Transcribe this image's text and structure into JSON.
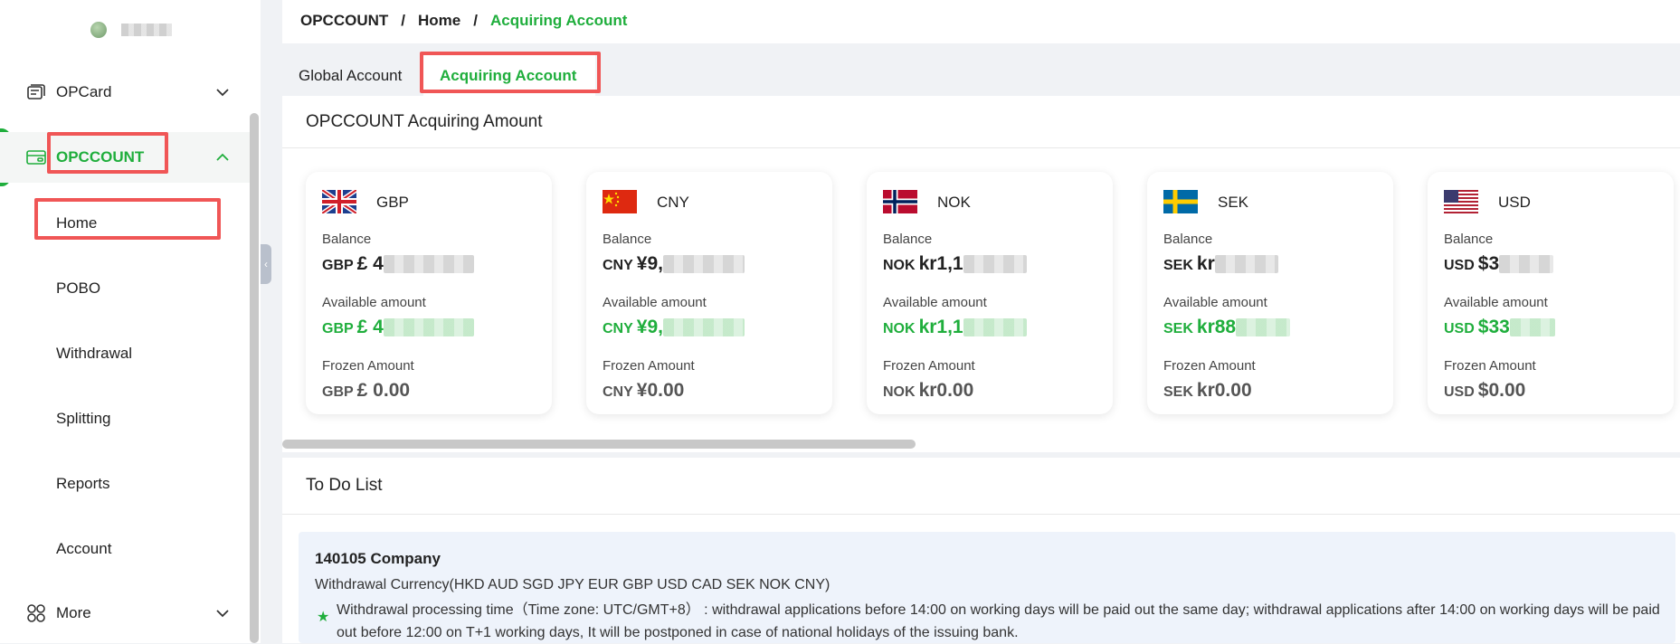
{
  "sidebar": {
    "groups": [
      {
        "label": "OPCard",
        "icon": "card-stack-icon"
      },
      {
        "label": "OPCCOUNT",
        "icon": "wallet-icon"
      },
      {
        "label": "More",
        "icon": "grid-icon"
      }
    ],
    "sub_items": [
      "Home",
      "POBO",
      "Withdrawal",
      "Splitting",
      "Reports",
      "Account"
    ]
  },
  "breadcrumb": {
    "root": "OPCCOUNT",
    "sep1": "/",
    "mid": "Home",
    "sep2": "/",
    "current": "Acquiring Account"
  },
  "tabs": {
    "global": "Global Account",
    "acquiring": "Acquiring Account"
  },
  "amount_panel": {
    "title": "OPCCOUNT Acquiring Amount"
  },
  "labels": {
    "balance": "Balance",
    "available": "Available amount",
    "frozen": "Frozen Amount"
  },
  "cards": [
    {
      "currency": "GBP",
      "flag": "uk-flag-icon",
      "balance_prefix": "£ 4",
      "available_prefix": "£ 4",
      "frozen": "£ 0.00"
    },
    {
      "currency": "CNY",
      "flag": "china-flag-icon",
      "balance_prefix": "¥9,",
      "available_prefix": "¥9,",
      "frozen": "¥0.00"
    },
    {
      "currency": "NOK",
      "flag": "norway-flag-icon",
      "balance_prefix": "kr1,1",
      "available_prefix": "kr1,1",
      "frozen": "kr0.00"
    },
    {
      "currency": "SEK",
      "flag": "sweden-flag-icon",
      "balance_prefix": "kr",
      "available_prefix": "kr88",
      "frozen": "kr0.00"
    },
    {
      "currency": "USD",
      "flag": "usa-flag-icon",
      "balance_prefix": "$3",
      "available_prefix": "$33",
      "frozen": "$0.00"
    }
  ],
  "todo": {
    "title": "To Do List",
    "company": "140105 Company",
    "currency_line": "Withdrawal Currency(HKD AUD SGD JPY EUR GBP USD CAD SEK NOK CNY)",
    "processing": "Withdrawal processing time（Time zone: UTC/GMT+8） : withdrawal applications before 14:00 on working days will be paid out the same day; withdrawal applications after 14:00 on working days will be paid out before 12:00 on T+1 working days, It will be postponed in case of national holidays of the issuing bank."
  },
  "colors": {
    "accent": "#1fae3c",
    "highlight": "#f05656"
  }
}
